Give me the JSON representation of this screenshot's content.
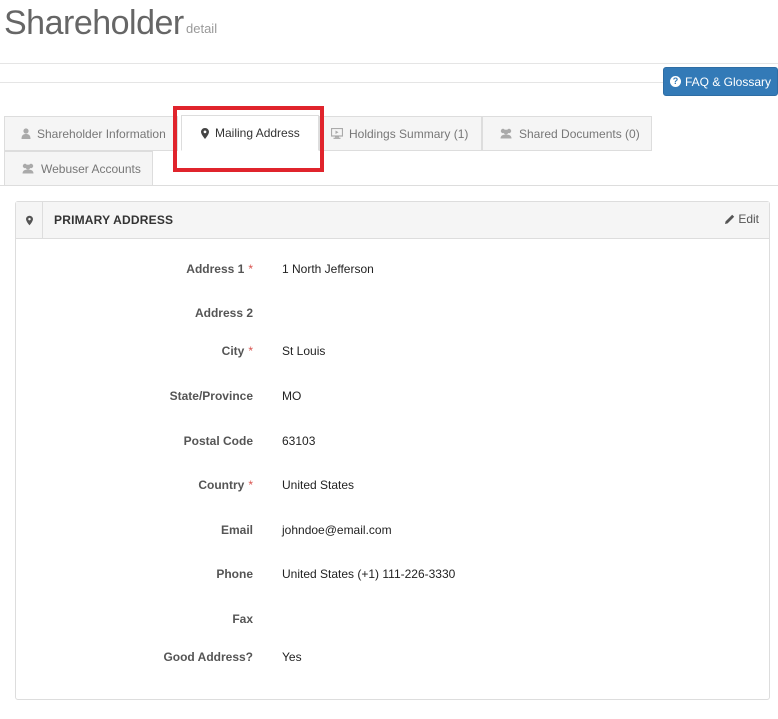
{
  "header": {
    "title": "Shareholder",
    "subtitle": "detail"
  },
  "faq_button": {
    "label": "FAQ & Glossary",
    "icon": "question-circle-icon"
  },
  "tabs": [
    {
      "label": "Shareholder Information",
      "icon": "user-icon",
      "active": false
    },
    {
      "label": "Mailing Address",
      "icon": "map-marker-icon",
      "active": true
    },
    {
      "label": "Holdings Summary (1)",
      "icon": "desktop-icon",
      "active": false
    },
    {
      "label": "Shared Documents (0)",
      "icon": "users-icon",
      "active": false
    },
    {
      "label": "Webuser Accounts",
      "icon": "users-icon",
      "active": false
    }
  ],
  "panel": {
    "title": "PRIMARY ADDRESS",
    "edit_label": "Edit",
    "fields": [
      {
        "label": "Address 1",
        "required": "*",
        "value": "1 North Jefferson"
      },
      {
        "label": "Address 2",
        "required": "",
        "value": ""
      },
      {
        "label": "City",
        "required": "*",
        "value": "St Louis"
      },
      {
        "label": "State/Province",
        "required": "",
        "value": "MO"
      },
      {
        "label": "Postal Code",
        "required": "",
        "value": "63103"
      },
      {
        "label": "Country",
        "required": "*",
        "value": "United States"
      },
      {
        "label": "Email",
        "required": "",
        "value": "johndoe@email.com"
      },
      {
        "label": "Phone",
        "required": "",
        "value": "United States (+1) 111-226-3330"
      },
      {
        "label": "Fax",
        "required": "",
        "value": ""
      },
      {
        "label": "Good Address?",
        "required": "",
        "value": "Yes"
      }
    ]
  },
  "colors": {
    "primary_button": "#337ab7",
    "highlight_box": "#e0242c",
    "required_asterisk": "#d9534f"
  }
}
